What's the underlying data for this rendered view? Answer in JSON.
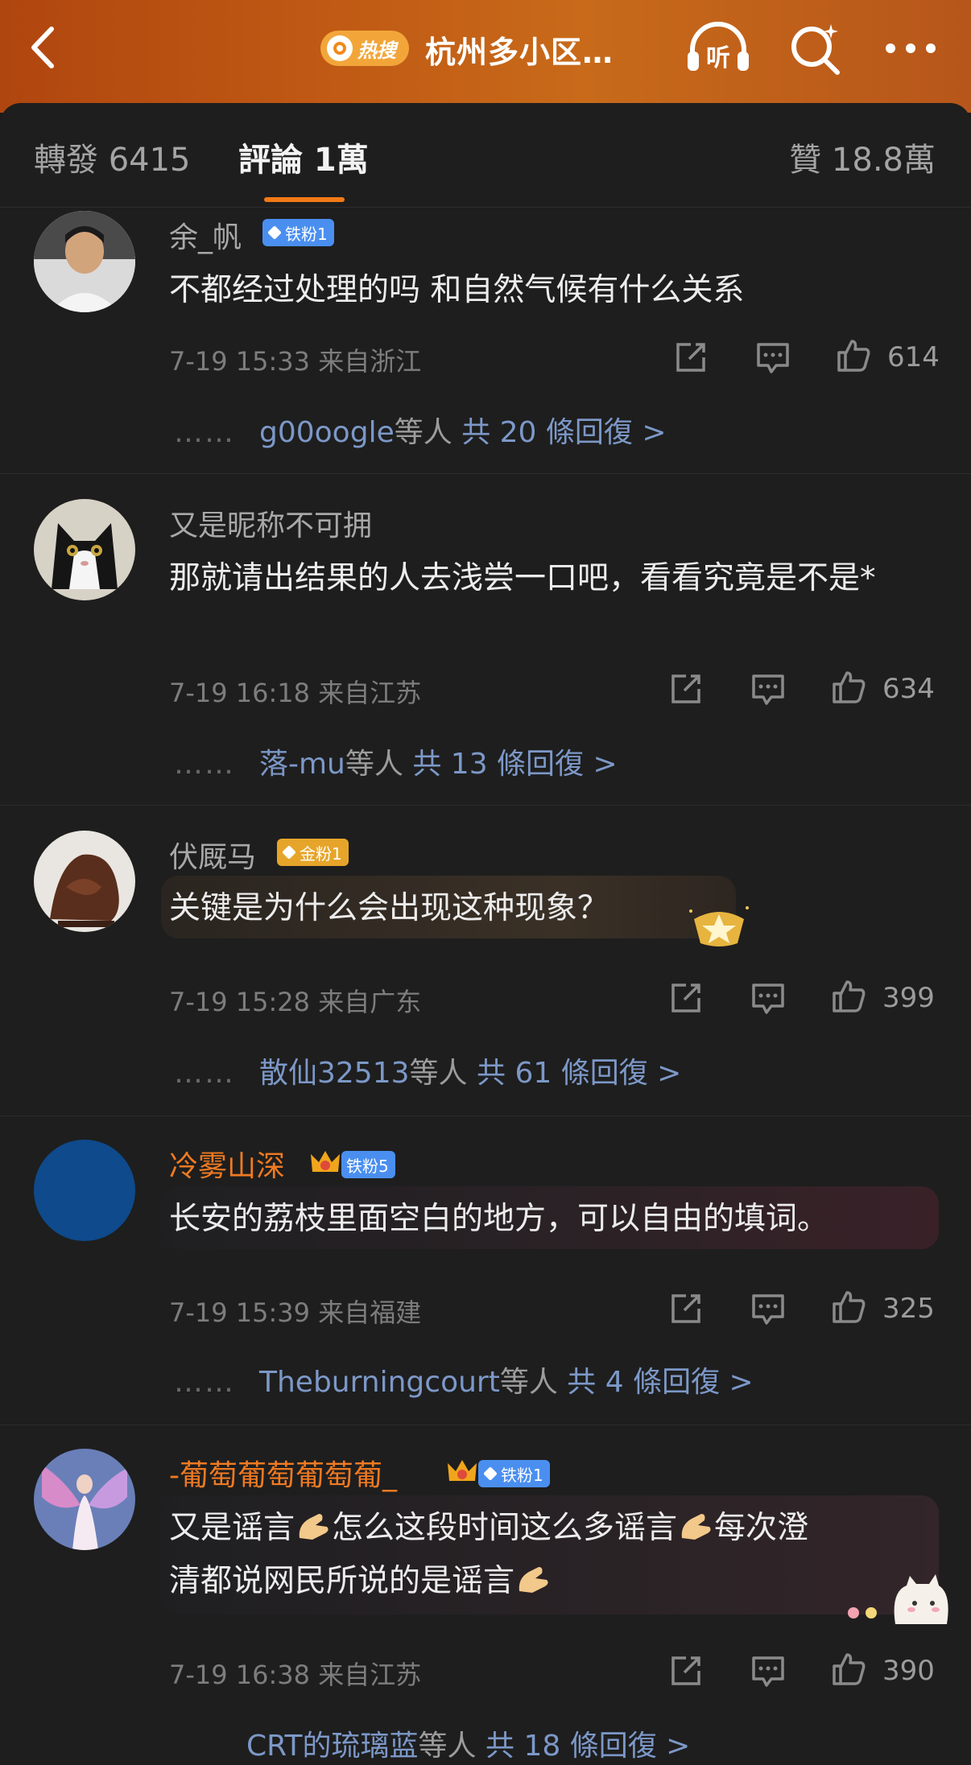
{
  "header": {
    "hot_label": "热搜",
    "topic": "杭州多小区…"
  },
  "tabs": [
    {
      "label": "轉發 6415"
    },
    {
      "label": "評論 1萬"
    },
    {
      "label": "贊 18.8萬"
    }
  ],
  "colors": {
    "accent": "#f27a16",
    "reply_link": "#7c98c8",
    "badge_blue": "#4a8ff0",
    "badge_gold": "#e6a52a",
    "orange_name": "#f07a22"
  },
  "comments": [
    {
      "user": "余_帆",
      "badge": "铁粉1",
      "text": "不都经过处理的吗 和自然气候有什么关系",
      "meta": "7-19 15:33 来自浙江",
      "likes": "614",
      "reply_dots": "……",
      "reply_user": "g00oogle",
      "reply_mid": "等人",
      "reply_total": "共 20 條回復 >"
    },
    {
      "user": "又是昵称不可拥",
      "text": "那就请出结果的人去浅尝一口吧，看看究竟是不是*",
      "meta": "7-19 16:18 来自江苏",
      "likes": "634",
      "reply_dots": "……",
      "reply_user": "落-mu",
      "reply_mid": "等人",
      "reply_total": "共 13 條回復 >"
    },
    {
      "user": "伏厩马",
      "badge": "金粉1",
      "text": "关键是为什么会出现这种现象？",
      "meta": "7-19 15:28 来自广东",
      "likes": "399",
      "reply_dots": "……",
      "reply_user": "散仙32513",
      "reply_mid": "等人",
      "reply_total": "共 61 條回復 >"
    },
    {
      "user": "冷雾山深",
      "badge": "铁粉5",
      "text": "长安的荔枝里面空白的地方，可以自由的填词。",
      "meta": "7-19 15:39 来自福建",
      "likes": "325",
      "reply_dots": "……",
      "reply_user": "Theburningcourt",
      "reply_mid": "等人",
      "reply_total": "共 4 條回復 >"
    },
    {
      "user": "-葡萄葡萄葡萄葡_",
      "badge": "铁粉1",
      "text_parts": [
        "又是谣言",
        "怎么这段时间这么多谣言",
        "每次澄",
        "清都说网民所说的是谣言"
      ],
      "meta": "7-19 16:38 来自江苏",
      "likes": "390",
      "reply_user": "CRT的琉璃蓝",
      "reply_mid": "等人",
      "reply_total": "共 18 條回復 >"
    }
  ]
}
